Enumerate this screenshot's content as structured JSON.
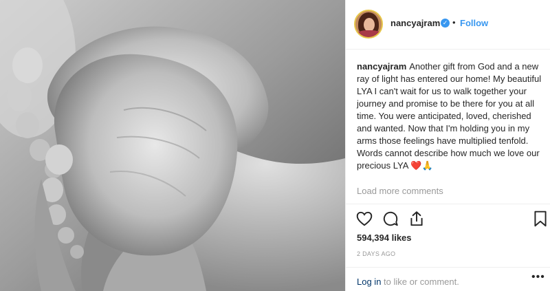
{
  "post": {
    "username": "nancyajram",
    "verified_mark": "✓",
    "separator": "•",
    "follow_label": "Follow"
  },
  "caption": {
    "username": "nancyajram",
    "text_para1": "Another gift from God and a new ray of light has entered our home! My beautiful LYA I can't wait for us to walk together your journey and promise to be there for you at all time. You were anticipated, loved, cherished and wanted. Now that I'm holding you in my arms those feelings have multiplied tenfold.",
    "text_para2": "Words cannot describe how much we love our precious LYA ❤️🙏"
  },
  "comments": {
    "load_more_label": "Load more comments"
  },
  "actions": {
    "icons": [
      "heart-icon",
      "comment-icon",
      "share-icon",
      "bookmark-icon"
    ]
  },
  "stats": {
    "likes": "594,394 likes",
    "time_ago": "2 DAYS AGO"
  },
  "footer": {
    "login_link": "Log in",
    "login_suffix": " to like or comment.",
    "more_icon": "•••"
  },
  "colors": {
    "accent": "#3897f0",
    "text": "#262626",
    "muted": "#999999",
    "link": "#003569",
    "border": "#efefef"
  }
}
